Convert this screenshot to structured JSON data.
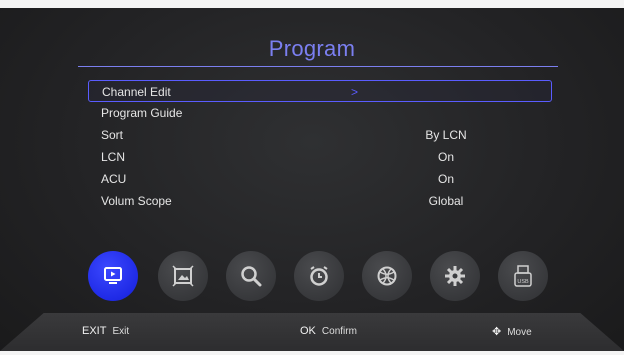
{
  "title": "Program",
  "menu": [
    {
      "label": "Channel Edit",
      "value": ""
    },
    {
      "label": "Program Guide",
      "value": ""
    },
    {
      "label": "Sort",
      "value": "By LCN"
    },
    {
      "label": "LCN",
      "value": "On"
    },
    {
      "label": "ACU",
      "value": "On"
    },
    {
      "label": "Volum Scope",
      "value": "Global"
    }
  ],
  "footer": {
    "exit_key": "EXIT",
    "exit_label": "Exit",
    "ok_key": "OK",
    "ok_label": "Confirm",
    "move_label": "Move"
  },
  "icons": [
    "tv-icon",
    "picture-icon",
    "search-icon",
    "timer-icon",
    "network-icon",
    "settings-icon",
    "usb-icon"
  ],
  "colors": {
    "accent": "#5a5cff",
    "title": "#7b7ff0",
    "active_icon": "#1f2ae6"
  }
}
